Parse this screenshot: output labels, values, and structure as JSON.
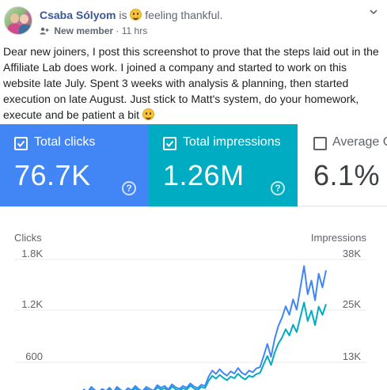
{
  "post": {
    "author": "Csaba Sólyom",
    "is_word": "is",
    "emoji_icon": "smiling-face-emoji",
    "feeling": "feeling thankful.",
    "member_badge": "New member",
    "separator": "·",
    "time": "11 hrs",
    "body": "Dear new joiners, I post this screenshot to prove that the steps laid out in the Affiliate Lab does work. I joined a company and started to work on this website late July. Spent 3 weeks with analysis & planning, then started execution on late August. Just stick to Matt's system, do your homework, execute and be patient a bit"
  },
  "cards": {
    "clicks": {
      "label": "Total clicks",
      "value": "76.7K",
      "checked": true,
      "help": "?"
    },
    "impressions": {
      "label": "Total impressions",
      "value": "1.26M",
      "checked": true,
      "help": "?"
    },
    "avg": {
      "label": "Average C",
      "value": "6.1%",
      "checked": false
    }
  },
  "colors": {
    "clicks": "#4285f4",
    "impressions": "#00acc1",
    "link": "#385898"
  },
  "chart_data": {
    "type": "line",
    "ylabel": "Clicks",
    "y2label": "Impressions",
    "y_ticks": [
      "1.8K",
      "1.2K",
      "600"
    ],
    "y2_ticks": [
      "38K",
      "25K",
      "13K"
    ],
    "ylim": [
      0,
      1800
    ],
    "y2lim": [
      0,
      38000
    ],
    "series": [
      {
        "name": "Clicks",
        "axis": "left",
        "values": [
          60,
          70,
          55,
          75,
          65,
          80,
          70,
          95,
          85,
          110,
          100,
          130,
          120,
          105,
          140,
          160,
          130,
          190,
          150,
          210,
          175,
          240,
          200,
          180,
          215,
          190,
          230,
          175,
          240,
          205,
          180,
          225,
          200,
          250,
          210,
          190,
          240,
          215,
          195,
          260,
          230,
          250,
          210,
          270,
          235,
          215,
          250,
          230,
          280,
          245,
          225,
          265,
          250,
          360,
          430,
          390,
          445,
          400,
          370,
          420,
          395,
          460,
          405,
          380,
          430,
          410,
          455,
          470,
          600,
          740,
          590,
          800,
          950,
          1050,
          1180,
          1080,
          1260,
          1140,
          1400,
          1650,
          1320,
          1480,
          1250,
          1560,
          1400,
          1600
        ]
      },
      {
        "name": "Impressions",
        "axis": "right",
        "values": [
          1500,
          1700,
          1400,
          1800,
          1600,
          1900,
          1700,
          2200,
          2000,
          2500,
          2300,
          2800,
          2600,
          2300,
          3000,
          3400,
          2800,
          3900,
          3200,
          4300,
          3700,
          4900,
          4200,
          3800,
          4500,
          4000,
          4800,
          3700,
          5000,
          4300,
          3800,
          4700,
          4200,
          5200,
          4400,
          4000,
          5000,
          4500,
          4100,
          5400,
          4800,
          5200,
          4400,
          5600,
          4900,
          4500,
          5200,
          4800,
          5800,
          5100,
          4700,
          5500,
          5200,
          7000,
          8200,
          7500,
          8400,
          7700,
          7100,
          8000,
          7600,
          8700,
          7800,
          7300,
          8200,
          7900,
          8600,
          8900,
          11000,
          13000,
          10800,
          13800,
          16000,
          17500,
          19500,
          18000,
          20600,
          18800,
          22500,
          26000,
          21500,
          24000,
          20500,
          25000,
          23000,
          25600
        ]
      }
    ],
    "grid": true,
    "legend": "none"
  }
}
